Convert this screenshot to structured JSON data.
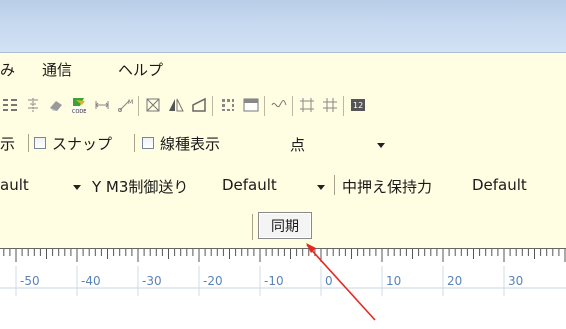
{
  "menu": {
    "items": [
      {
        "label": "み"
      },
      {
        "label": "通信"
      },
      {
        "label": "ヘルプ"
      }
    ]
  },
  "toolbar": {
    "icons": [
      "sort-icon",
      "align-icon",
      "eraser-icon",
      "barcode-icon",
      "dimension-icon",
      "coordinate-icon",
      "box-icon",
      "mirror-icon",
      "shape-icon",
      "grid-icon",
      "table-icon",
      "wave-icon",
      "snap-grid-icon",
      "snap-grid2-icon",
      "number-icon"
    ]
  },
  "view_options": {
    "prefix": "示",
    "snap_label": "スナップ",
    "linetype_label": "線種表示",
    "point_value": "点"
  },
  "params": {
    "x_value": "ault",
    "y_label": "Y M3制御送り",
    "y_value": "Default",
    "hold_label": "中押え保持力",
    "hold_value": "Default"
  },
  "sync": {
    "label": "同期"
  },
  "ruler": {
    "labels": [
      "-50",
      "-40",
      "-30",
      "-20",
      "-10",
      "0",
      "10",
      "20",
      "30"
    ]
  },
  "colors": {
    "panel_bg": "#fffde2",
    "titlebar": "#c6d8f0",
    "annotation_arrow": "#e8281f",
    "ruler_label": "#5a84b8"
  }
}
